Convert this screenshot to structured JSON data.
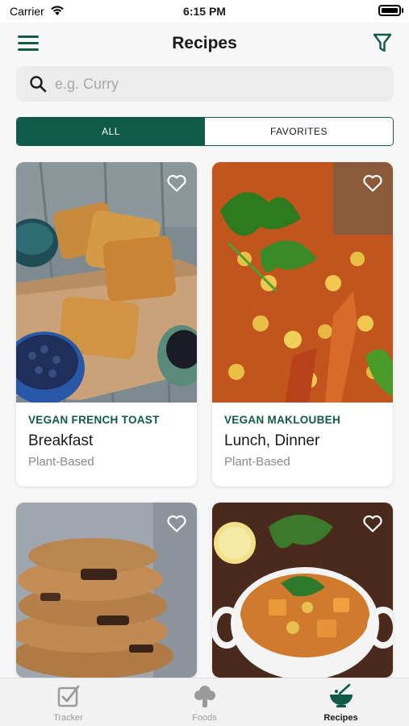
{
  "status_bar": {
    "carrier": "Carrier",
    "time": "6:15 PM",
    "icons": [
      "wifi-icon",
      "battery-icon"
    ]
  },
  "header": {
    "title": "Recipes",
    "left_icon": "menu-icon",
    "right_icon": "filter-icon"
  },
  "search": {
    "placeholder": "e.g. Curry",
    "value": "",
    "icon": "search-icon"
  },
  "segments": [
    {
      "label": "ALL",
      "selected": true
    },
    {
      "label": "FAVORITES",
      "selected": false
    }
  ],
  "recipes": [
    {
      "name": "VEGAN FRENCH TOAST",
      "meal": "Breakfast",
      "category": "Plant-Based",
      "image": "french-toast-photo",
      "favorite": false
    },
    {
      "name": "VEGAN MAKLOUBEH",
      "meal": "Lunch, Dinner",
      "category": "Plant-Based",
      "image": "makloubeh-photo",
      "favorite": false
    },
    {
      "name": "",
      "meal": "",
      "category": "",
      "image": "cookies-photo",
      "favorite": false
    },
    {
      "name": "",
      "meal": "",
      "category": "",
      "image": "stew-photo",
      "favorite": false
    }
  ],
  "tab_bar": {
    "tabs": [
      {
        "label": "Tracker",
        "icon": "tracker-icon",
        "active": false
      },
      {
        "label": "Foods",
        "icon": "foods-icon",
        "active": false
      },
      {
        "label": "Recipes",
        "icon": "recipes-icon",
        "active": true
      }
    ]
  },
  "colors": {
    "accent": "#0f5a48",
    "background": "#f7f7f7",
    "search_bg": "#ececec",
    "muted_text": "#8a8a8a"
  }
}
